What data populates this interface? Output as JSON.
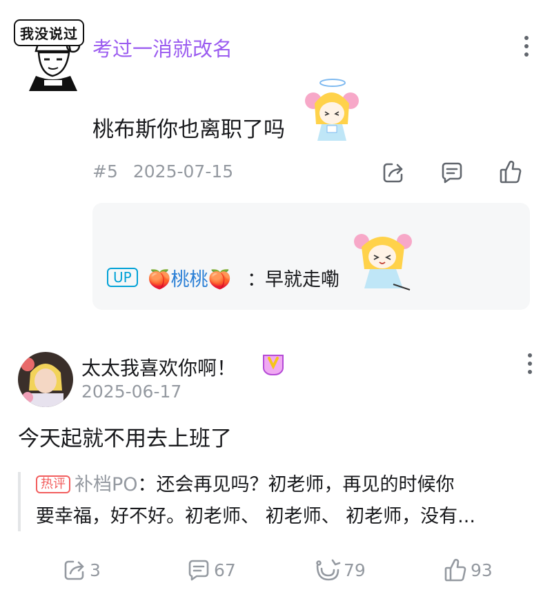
{
  "comment1": {
    "avatar_badge": "我没说过",
    "username": "考过一消就改名",
    "text": "桃布斯你也离职了吗",
    "floor": "#5",
    "date": "2025-07-15",
    "reply": {
      "tag": "UP",
      "user": "🍑桃桃🍑",
      "colon": "：",
      "text": "早就走嘞"
    }
  },
  "comment2": {
    "username": "太太我喜欢你啊！",
    "date": "2025-06-17",
    "text": "今天起就不用去上班了",
    "hot": {
      "tag": "热评",
      "user": "补档PO",
      "line1_rest": "：还会再见吗？初老师，再见的时候你",
      "line2": "要幸福，好不好。初老师、 初老师、 初老师，没有..."
    },
    "stats": {
      "share": "3",
      "reply": "67",
      "charge": "79",
      "like": "93"
    }
  },
  "colors": {
    "username_purple": "#9b5cf0",
    "up_blue": "#00a1d6",
    "hot_red": "#f25d5d",
    "meta_gray": "#9499a0"
  },
  "icons": [
    "share-icon",
    "reply-icon",
    "like-icon",
    "charge-icon",
    "more-icon"
  ]
}
